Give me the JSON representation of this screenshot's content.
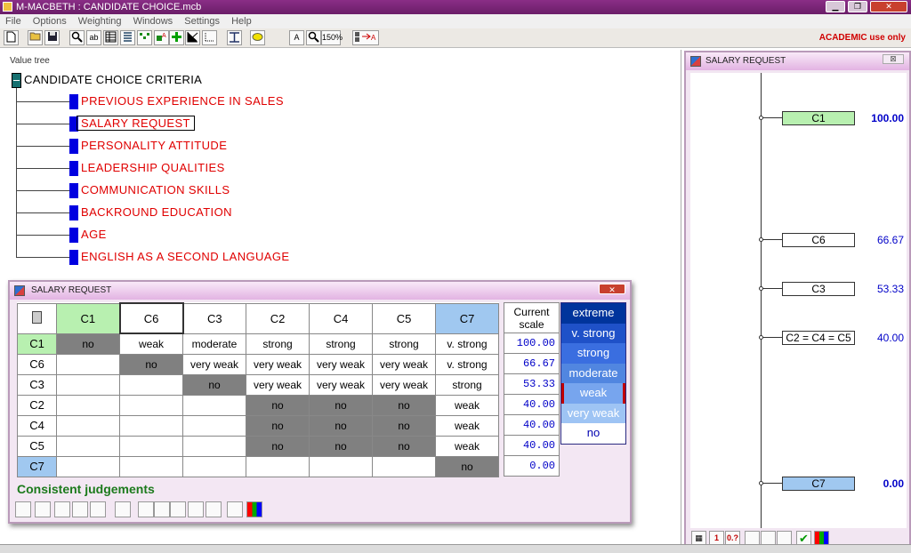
{
  "window": {
    "title": "M-MACBETH : CANDIDATE CHOICE.mcb",
    "minimize": "▁",
    "restore": "❐",
    "close": "✕"
  },
  "menu": [
    "File",
    "Options",
    "Weighting",
    "Windows",
    "Settings",
    "Help"
  ],
  "toolbar": {
    "zoom_label": "150%",
    "academic": "ACADEMIC use only"
  },
  "value_tree": {
    "label": "Value tree",
    "root": "CANDIDATE CHOICE CRITERIA",
    "criteria": [
      "PREVIOUS EXPERIENCE IN SALES",
      "SALARY REQUEST",
      "PERSONALITY ATTITUDE",
      "LEADERSHIP QUALITIES",
      "COMMUNICATION SKILLS",
      "BACKROUND EDUCATION",
      "AGE",
      "ENGLISH AS A SECOND LANGUAGE"
    ],
    "selected_index": 1
  },
  "matrix_window": {
    "title": "SALARY REQUEST",
    "close": "✕",
    "columns": [
      "C1",
      "C6",
      "C3",
      "C2",
      "C4",
      "C5",
      "C7"
    ],
    "rows": [
      {
        "label": "C1",
        "cells": [
          "no",
          "weak",
          "moderate",
          "strong",
          "strong",
          "strong",
          "v. strong"
        ]
      },
      {
        "label": "C6",
        "cells": [
          "",
          "no",
          "very weak",
          "very weak",
          "very weak",
          "very weak",
          "v. strong"
        ]
      },
      {
        "label": "C3",
        "cells": [
          "",
          "",
          "no",
          "very weak",
          "very weak",
          "very weak",
          "strong"
        ]
      },
      {
        "label": "C2",
        "cells": [
          "",
          "",
          "",
          "no",
          "no",
          "no",
          "weak"
        ]
      },
      {
        "label": "C4",
        "cells": [
          "",
          "",
          "",
          "no",
          "no",
          "no",
          "weak"
        ]
      },
      {
        "label": "C5",
        "cells": [
          "",
          "",
          "",
          "no",
          "no",
          "no",
          "weak"
        ]
      },
      {
        "label": "C7",
        "cells": [
          "",
          "",
          "",
          "",
          "",
          "",
          "no"
        ]
      }
    ],
    "scale_header": "Current scale",
    "scale": [
      "100.00",
      "66.67",
      "53.33",
      "40.00",
      "40.00",
      "40.00",
      "0.00"
    ],
    "semantic_categories": [
      "extreme",
      "v. strong",
      "strong",
      "moderate",
      "weak",
      "very weak",
      "no"
    ],
    "status": "Consistent judgements"
  },
  "scale_window": {
    "title": "SALARY REQUEST",
    "close": "⊠",
    "points": [
      {
        "label": "C1",
        "value": "100.00"
      },
      {
        "label": "C6",
        "value": "66.67"
      },
      {
        "label": "C3",
        "value": "53.33"
      },
      {
        "label": "C2 = C4 = C5",
        "value": "40.00"
      },
      {
        "label": "C7",
        "value": "0.00"
      }
    ],
    "toolbar_text": [
      "1",
      "0.?"
    ]
  }
}
